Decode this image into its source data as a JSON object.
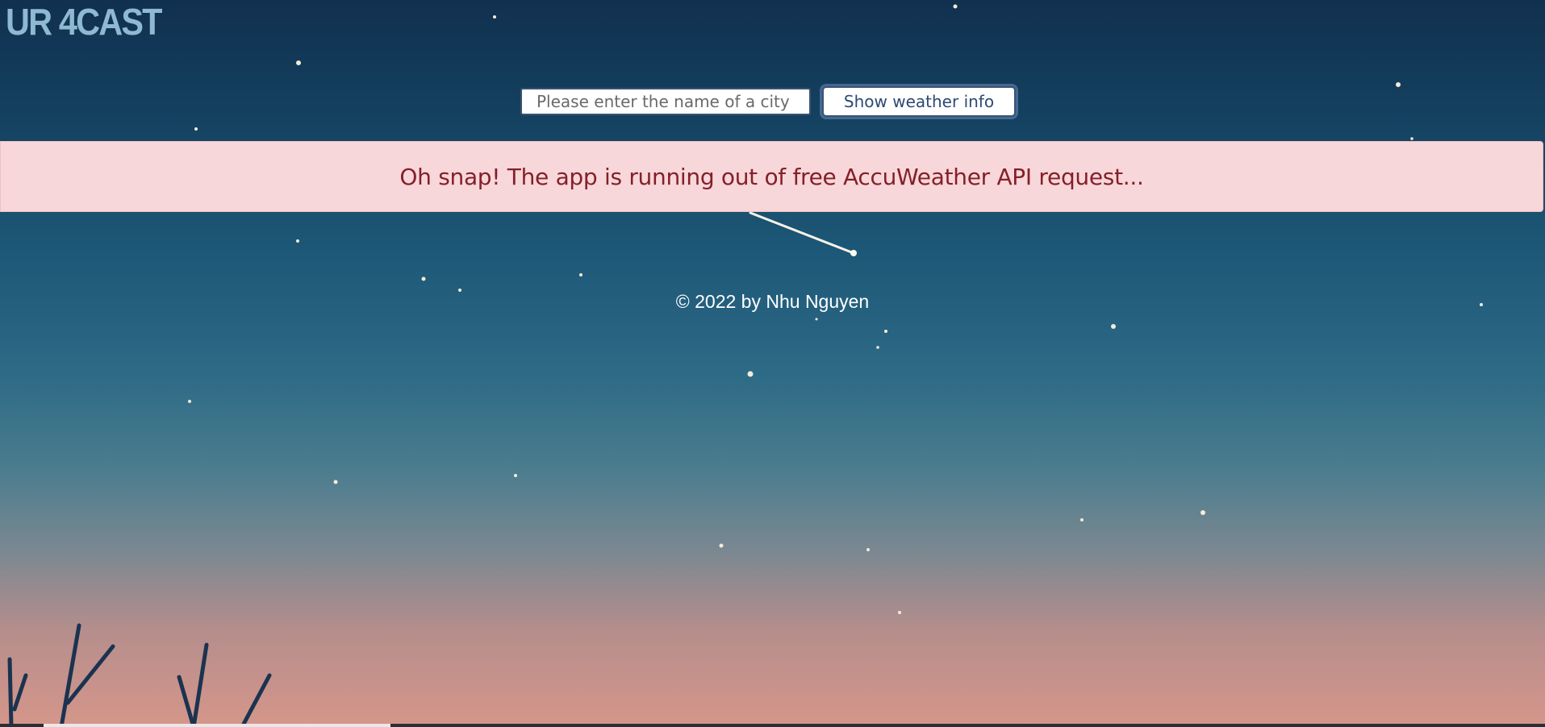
{
  "app": {
    "brand": "UR 4CAST"
  },
  "search": {
    "placeholder": "Please enter the name of a city",
    "value": "",
    "button_label": "Show weather info"
  },
  "alert": {
    "message": "Oh snap! The app is running out of free AccuWeather API request..."
  },
  "footer": {
    "text": "© 2022 by Nhu Nguyen"
  },
  "colors": {
    "brand": "#8fb8d2",
    "alert_background": "#f8d7da",
    "alert_text": "#842029",
    "button_text": "#2c4a74",
    "sky_top": "#11304f",
    "sky_bottom": "#d5968a"
  },
  "background": {
    "description_icon": "night-sky-illustration"
  }
}
